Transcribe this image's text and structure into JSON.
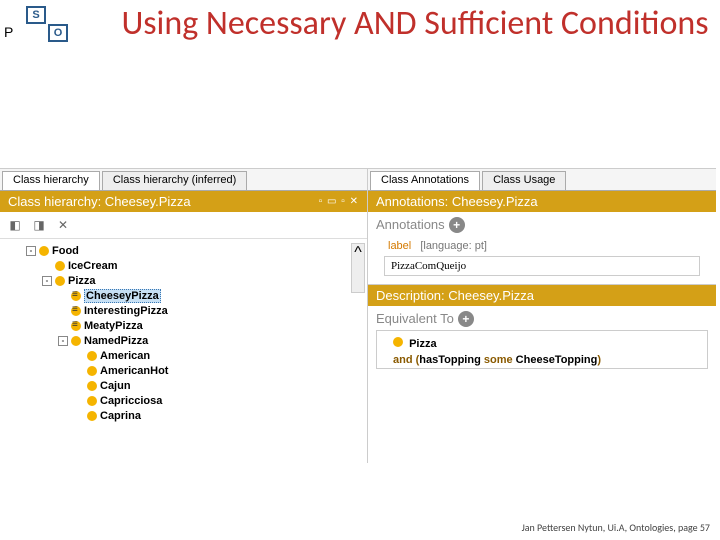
{
  "topIcons": {
    "s": "S",
    "p": "P",
    "o": "O"
  },
  "title": "Using Necessary AND Sufficient Conditions",
  "left": {
    "tabs": [
      "Class hierarchy",
      "Class hierarchy (inferred)"
    ],
    "header": "Class hierarchy: Cheesey.Pizza",
    "winCtrl": "▫ ▭ ▫ ✕",
    "tree": [
      {
        "ind": 1,
        "toggle": "-",
        "dot": "plain",
        "label": "Food",
        "sel": false
      },
      {
        "ind": 2,
        "toggle": "",
        "dot": "plain",
        "label": "IceCream",
        "sel": false
      },
      {
        "ind": 2,
        "toggle": "-",
        "dot": "plain",
        "label": "Pizza",
        "sel": false
      },
      {
        "ind": 3,
        "toggle": "",
        "dot": "equiv",
        "label": "CheeseyPizza",
        "sel": true
      },
      {
        "ind": 3,
        "toggle": "",
        "dot": "equiv",
        "label": "InterestingPizza",
        "sel": false
      },
      {
        "ind": 3,
        "toggle": "",
        "dot": "equiv",
        "label": "MeatyPizza",
        "sel": false
      },
      {
        "ind": 3,
        "toggle": "-",
        "dot": "plain",
        "label": "NamedPizza",
        "sel": false
      },
      {
        "ind": 3,
        "toggle": "",
        "dot": "plain",
        "label": "American",
        "sel": false,
        "extra": 16
      },
      {
        "ind": 3,
        "toggle": "",
        "dot": "plain",
        "label": "AmericanHot",
        "sel": false,
        "extra": 16
      },
      {
        "ind": 3,
        "toggle": "",
        "dot": "plain",
        "label": "Cajun",
        "sel": false,
        "extra": 16
      },
      {
        "ind": 3,
        "toggle": "",
        "dot": "plain",
        "label": "Capricciosa",
        "sel": false,
        "extra": 16
      },
      {
        "ind": 3,
        "toggle": "",
        "dot": "plain",
        "label": "Caprina",
        "sel": false,
        "extra": 16
      }
    ]
  },
  "right": {
    "tabs": [
      "Class Annotations",
      "Class Usage"
    ],
    "annHeader": "Annotations: Cheesey.Pizza",
    "annLabel": "Annotations",
    "annEntry": {
      "label": "label",
      "lang": "[language: pt]",
      "value": "PizzaComQueijo"
    },
    "descHeader": "Description: Cheesey.Pizza",
    "equivLabel": "Equivalent To",
    "equiv": {
      "row1": {
        "dot": true,
        "text": "Pizza"
      },
      "row2": {
        "prefix": "and (",
        "prop": "hasTopping",
        "restr": "some",
        "cls": "CheeseTopping",
        "suffix": ")"
      }
    }
  },
  "footer": "Jan Pettersen Nytun, Ui.A, Ontologies, page 57"
}
